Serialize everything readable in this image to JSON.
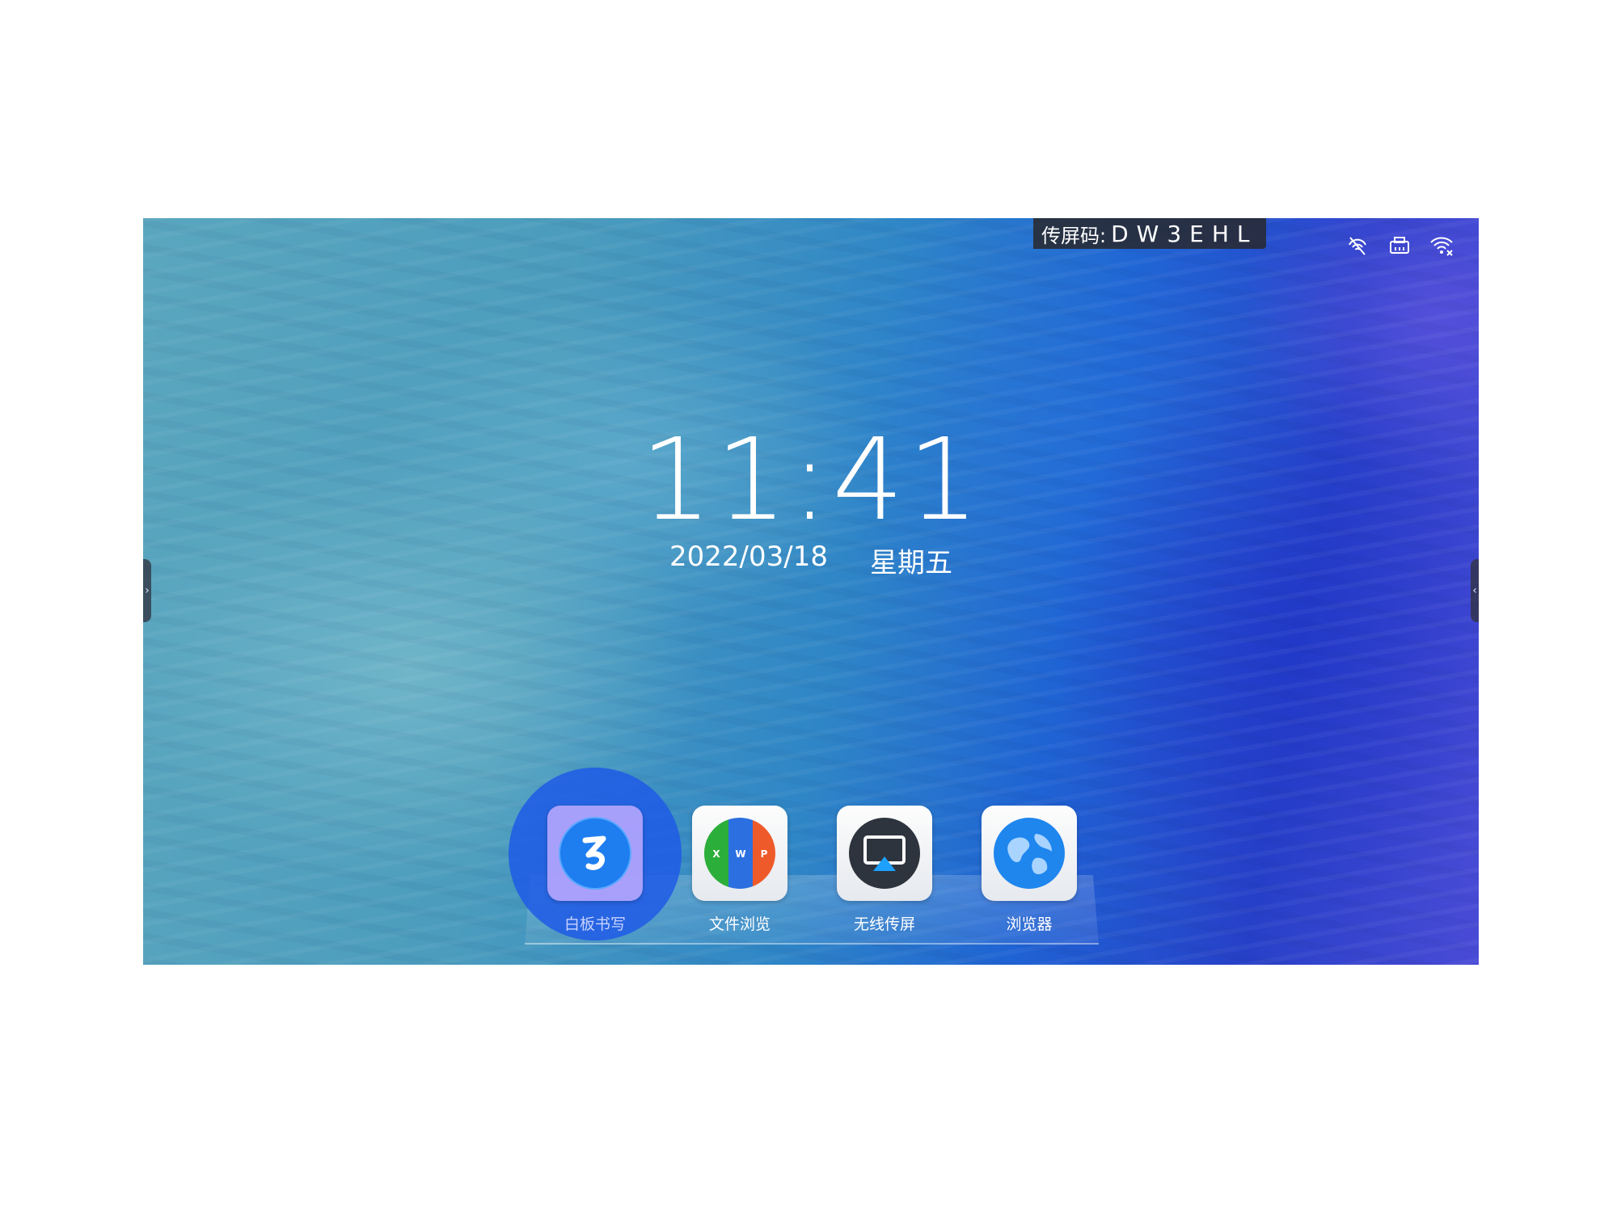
{
  "status_bar": {
    "cast_code_label": "传屏码:",
    "cast_code_value": "DW3EHL",
    "icons": [
      "no-signal-icon",
      "ethernet-icon",
      "wifi-disconnected-icon"
    ]
  },
  "clock": {
    "time": "11:41",
    "date": "2022/03/18",
    "weekday": "星期五"
  },
  "side_handles": {
    "left_glyph": "›",
    "right_glyph": "‹"
  },
  "dock": {
    "selected_index": 0,
    "apps": [
      {
        "label": "白板书写",
        "icon": "whiteboard-icon"
      },
      {
        "label": "文件浏览",
        "icon": "file-browser-icon"
      },
      {
        "label": "无线传屏",
        "icon": "wireless-cast-icon"
      },
      {
        "label": "浏览器",
        "icon": "browser-icon"
      }
    ]
  },
  "colors": {
    "wallpaper_left": "#5aa6bf",
    "wallpaper_right": "#4a4bd6",
    "selection_highlight": "#1e5ae6"
  }
}
